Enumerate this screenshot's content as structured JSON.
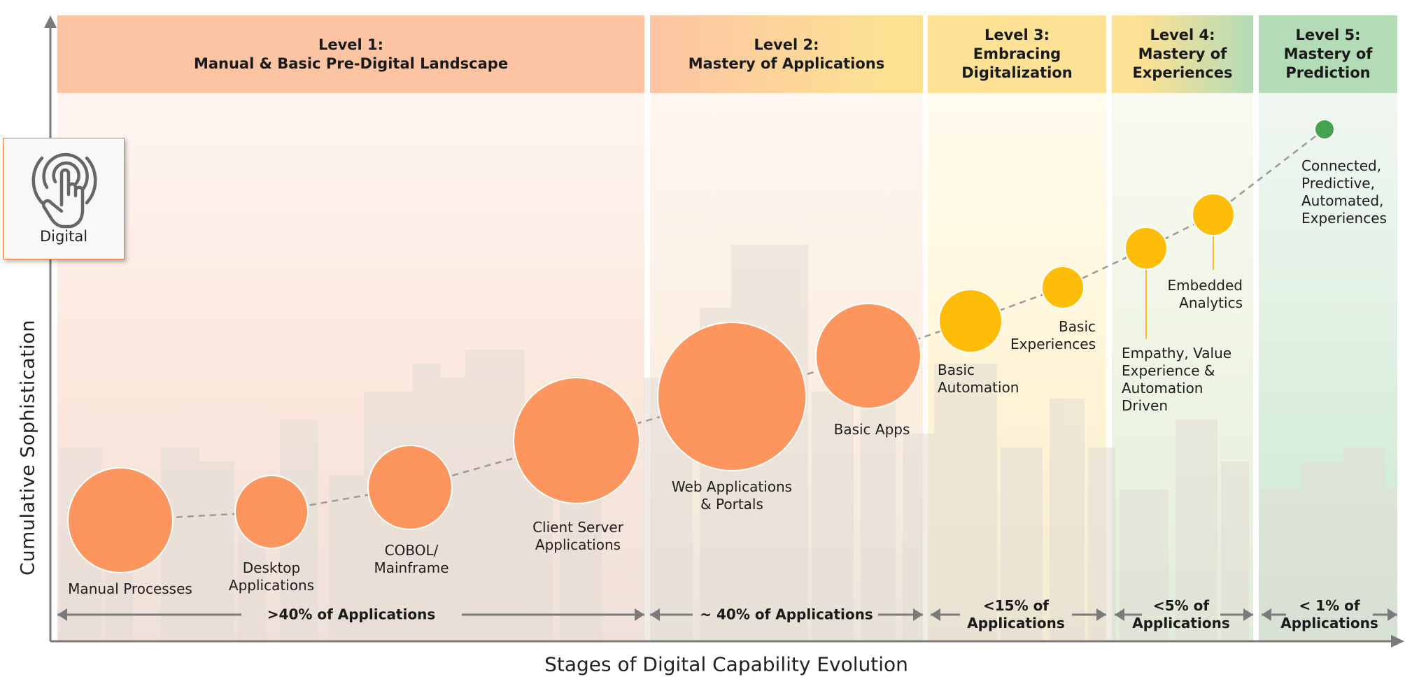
{
  "levels": [
    {
      "title": "Level 1:",
      "subtitle": "Manual & Basic Pre-Digital Landscape",
      "share": ">40% of Applications"
    },
    {
      "title": "Level 2:",
      "subtitle": "Mastery of Applications",
      "share": "~ 40% of Applications"
    },
    {
      "title": "Level 3:",
      "subtitle_lines": [
        "Embracing",
        "Digitalization"
      ],
      "share_lines": [
        "<15% of",
        "Applications"
      ]
    },
    {
      "title": "Level 4:",
      "subtitle_lines": [
        "Mastery of",
        "Experiences"
      ],
      "share_lines": [
        "<5% of",
        "Applications"
      ]
    },
    {
      "title": "Level 5:",
      "subtitle_lines": [
        "Mastery of",
        "Prediction"
      ],
      "share_lines": [
        "< 1% of",
        "Applications"
      ]
    }
  ],
  "digital_card": {
    "icon": "touch-hand-icon",
    "label": "Digital"
  },
  "axes": {
    "y_label": "Cumulative Sophistication",
    "x_label": "Stages of Digital Capability Evolution"
  },
  "stages": [
    {
      "id": "manual",
      "lines": [
        "Manual Processes"
      ],
      "level": 1,
      "color": "#fd955f",
      "relative_size": 75
    },
    {
      "id": "desktop",
      "lines": [
        "Desktop",
        "Applications"
      ],
      "level": 1,
      "color": "#fd955f",
      "relative_size": 52
    },
    {
      "id": "cobol",
      "lines": [
        "COBOL/",
        "Mainframe"
      ],
      "level": 1,
      "color": "#fd955f",
      "relative_size": 60
    },
    {
      "id": "client-server",
      "lines": [
        "Client Server",
        "Applications"
      ],
      "level": 1,
      "color": "#fd955f",
      "relative_size": 90
    },
    {
      "id": "web-apps",
      "lines": [
        "Web Applications",
        "& Portals"
      ],
      "level": 2,
      "color": "#fd955f",
      "relative_size": 106
    },
    {
      "id": "basic-apps",
      "lines": [
        "Basic Apps"
      ],
      "level": 2,
      "color": "#fd955f",
      "relative_size": 75
    },
    {
      "id": "basic-automation",
      "lines": [
        "Basic",
        "Automation"
      ],
      "level": 3,
      "color": "#fdbd09",
      "relative_size": 45
    },
    {
      "id": "basic-experiences",
      "lines": [
        "Basic",
        "Experiences"
      ],
      "level": 3,
      "color": "#fdbd09",
      "relative_size": 30
    },
    {
      "id": "empathy",
      "lines": [
        "Empathy, Value",
        "Experience &",
        "Automation",
        "Driven"
      ],
      "level": 4,
      "color": "#fdbd09",
      "relative_size": 30
    },
    {
      "id": "embedded-analytics",
      "lines": [
        "Embedded",
        "Analytics"
      ],
      "level": 4,
      "color": "#fdbd09",
      "relative_size": 30
    },
    {
      "id": "connected",
      "lines": [
        "Connected,",
        "Predictive,",
        "Automated,",
        "Experiences"
      ],
      "level": 5,
      "color": "#43a34f",
      "relative_size": 14
    }
  ],
  "colors": {
    "axis": "#7a7a7a",
    "trend_line": "#999999",
    "stem": "#f5bc2a"
  }
}
